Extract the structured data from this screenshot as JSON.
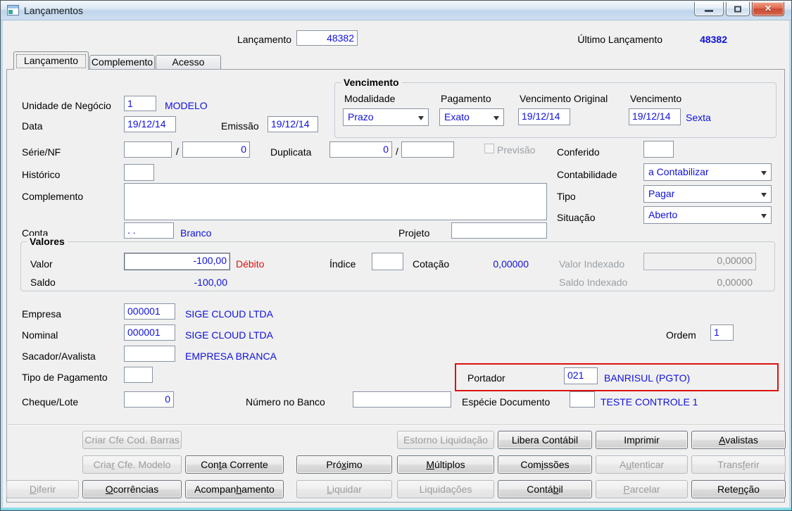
{
  "window": {
    "title": "Lançamentos"
  },
  "colors": {
    "accent_blue": "#1010dd",
    "alert_red": "#dd1111",
    "highlight_red": "#dd1111",
    "disabled_text": "#9b9b9b"
  },
  "header": {
    "lancamento_label": "Lançamento",
    "lancamento_value": "48382",
    "ultimo_label": "Último Lançamento",
    "ultimo_value": "48382"
  },
  "tabs": [
    {
      "label": "Lançamento",
      "active": true
    },
    {
      "label": "Complemento",
      "active": false
    },
    {
      "label": "Acesso",
      "active": false
    }
  ],
  "separators": {
    "slash": "/"
  },
  "form": {
    "unidade": {
      "label": "Unidade de Negócio",
      "value": "1",
      "desc": "MODELO"
    },
    "data": {
      "label": "Data",
      "value": "19/12/14"
    },
    "emissao": {
      "label": "Emissão",
      "value": "19/12/14"
    },
    "vencimento_group": {
      "title": "Vencimento",
      "modalidade": {
        "label": "Modalidade",
        "value": "Prazo"
      },
      "pagamento": {
        "label": "Pagamento",
        "value": "Exato"
      },
      "vencimento_original": {
        "label": "Vencimento Original",
        "value": "19/12/14"
      },
      "vencimento": {
        "label": "Vencimento",
        "value": "19/12/14",
        "weekday": "Sexta"
      }
    },
    "serie_nf": {
      "label": "Série/NF",
      "value1": "",
      "value2": "0"
    },
    "duplicata": {
      "label": "Duplicata",
      "value1": "0",
      "value2": ""
    },
    "previsao": {
      "label": "Previsão",
      "checked": false
    },
    "conferido": {
      "label": "Conferido",
      "value": ""
    },
    "historico": {
      "label": "Histórico",
      "value": ""
    },
    "contabilidade": {
      "label": "Contabilidade",
      "value": "a Contabilizar"
    },
    "complemento": {
      "label": "Complemento",
      "value": ""
    },
    "tipo": {
      "label": "Tipo",
      "value": "Pagar"
    },
    "situacao": {
      "label": "Situação",
      "value": "Aberto"
    },
    "conta": {
      "label": "Conta",
      "value": ". .",
      "desc": "Branco"
    },
    "projeto": {
      "label": "Projeto",
      "value": ""
    },
    "valores_group": {
      "title": "Valores",
      "valor": {
        "label": "Valor",
        "value": "-100,00",
        "tag": "Débito"
      },
      "indice": {
        "label": "Índice",
        "value": ""
      },
      "cotacao": {
        "label": "Cotação",
        "value": "0,00000"
      },
      "valor_indexado": {
        "label": "Valor Indexado",
        "value": "0,00000"
      },
      "saldo": {
        "label": "Saldo",
        "value": "-100,00"
      },
      "saldo_indexado": {
        "label": "Saldo Indexado",
        "value": "0,00000"
      }
    },
    "empresa": {
      "label": "Empresa",
      "value": "000001",
      "desc": "SIGE CLOUD LTDA"
    },
    "nominal": {
      "label": "Nominal",
      "value": "000001",
      "desc": "SIGE CLOUD LTDA"
    },
    "ordem": {
      "label": "Ordem",
      "value": "1"
    },
    "sacador": {
      "label": "Sacador/Avalista",
      "value": "",
      "desc": "EMPRESA BRANCA"
    },
    "tipo_pagamento": {
      "label": "Tipo de Pagamento",
      "value": ""
    },
    "portador": {
      "label": "Portador",
      "value": "021",
      "desc": "BANRISUL (PGTO)"
    },
    "cheque_lote": {
      "label": "Cheque/Lote",
      "value": "0"
    },
    "numero_banco": {
      "label": "Número no Banco",
      "value": ""
    },
    "especie_documento": {
      "label": "Espécie Documento",
      "value": "",
      "desc": "TESTE CONTROLE 1"
    }
  },
  "buttons": {
    "criar_cfe_barras": {
      "label": "Criar Cfe Cod. Barras",
      "u": -1,
      "enabled": false
    },
    "criar_cfe_modelo": {
      "label": "Criar Cfe. Modelo",
      "u": 4,
      "enabled": false
    },
    "conta_corrente": {
      "label": "Conta Corrente",
      "u": 3,
      "enabled": true
    },
    "proximo": {
      "label": "Próximo",
      "u": 3,
      "enabled": true
    },
    "diferir": {
      "label": "Diferir",
      "u": 0,
      "enabled": false
    },
    "ocorrencias": {
      "label": "Ocorrências",
      "u": 0,
      "enabled": true
    },
    "acompanhamento": {
      "label": "Acompanhamento",
      "u": 7,
      "enabled": true
    },
    "liquidar": {
      "label": "Liquidar",
      "u": 0,
      "enabled": false
    },
    "estorno_liquidacao": {
      "label": "Estorno Liquidação",
      "u": -1,
      "enabled": false
    },
    "libera_contabil": {
      "label": "Libera Contábil",
      "u": -1,
      "enabled": true
    },
    "imprimir": {
      "label": "Imprimir",
      "u": -1,
      "enabled": true
    },
    "avalistas": {
      "label": "Avalistas",
      "u": 0,
      "enabled": true
    },
    "multiplos": {
      "label": "Múltiplos",
      "u": 0,
      "enabled": true
    },
    "comissoes": {
      "label": "Comissões",
      "u": 3,
      "enabled": true
    },
    "autenticar": {
      "label": "Autenticar",
      "u": 1,
      "enabled": false
    },
    "transferir": {
      "label": "Transferir",
      "u": 5,
      "enabled": false
    },
    "liquidacoes": {
      "label": "Liquidações",
      "u": -1,
      "enabled": false
    },
    "contabil": {
      "label": "Contábil",
      "u": 5,
      "enabled": true
    },
    "parcelar": {
      "label": "Parcelar",
      "u": 0,
      "enabled": false
    },
    "retencao": {
      "label": "Retenção",
      "u": 4,
      "enabled": true
    }
  }
}
